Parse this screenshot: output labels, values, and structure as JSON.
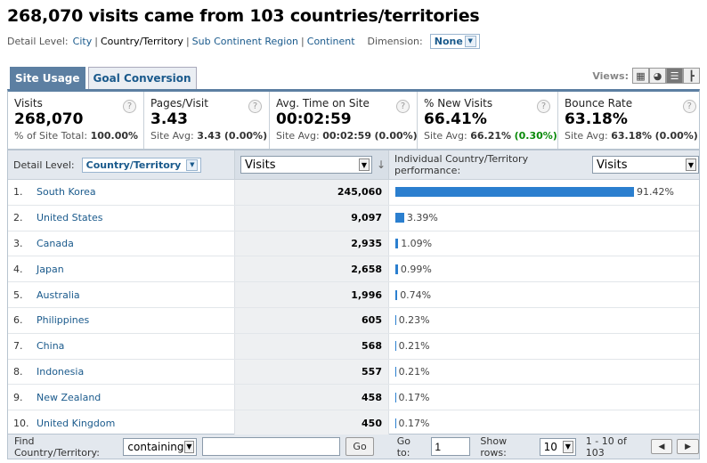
{
  "page": {
    "title": "268,070 visits came from 103 countries/territories"
  },
  "detail_level": {
    "label": "Detail Level:",
    "options": [
      "City",
      "Country/Territory",
      "Sub Continent Region",
      "Continent"
    ],
    "current": "Country/Territory",
    "dimension_label": "Dimension:",
    "dimension_value": "None"
  },
  "tabs": [
    {
      "label": "Site Usage",
      "active": true
    },
    {
      "label": "Goal Conversion",
      "active": false
    }
  ],
  "views": {
    "label": "Views:",
    "icons": [
      "table-icon",
      "pie-icon",
      "bar-icon",
      "comparison-icon"
    ],
    "active": "bar-icon"
  },
  "metrics": [
    {
      "label": "Visits",
      "value": "268,070",
      "sub_label": "% of Site Total:",
      "sub_value": "100.00%",
      "sub_extra": ""
    },
    {
      "label": "Pages/Visit",
      "value": "3.43",
      "sub_label": "Site Avg:",
      "sub_value": "3.43",
      "sub_extra": "(0.00%)"
    },
    {
      "label": "Avg. Time on Site",
      "value": "00:02:59",
      "sub_label": "Site Avg:",
      "sub_value": "00:02:59",
      "sub_extra": "(0.00%)"
    },
    {
      "label": "% New Visits",
      "value": "66.41%",
      "sub_label": "Site Avg:",
      "sub_value": "66.21%",
      "sub_extra": "(0.30%)"
    },
    {
      "label": "Bounce Rate",
      "value": "63.18%",
      "sub_label": "Site Avg:",
      "sub_value": "63.18%",
      "sub_extra": "(0.00%)"
    }
  ],
  "table": {
    "detail_label": "Detail Level:",
    "detail_value": "Country/Territory",
    "metric_select": "Visits",
    "performance_label": "Individual Country/Territory performance:",
    "performance_select": "Visits",
    "rows": [
      {
        "rank": "1.",
        "name": "South Korea",
        "visits": "245,060",
        "pct_label": "91.42%",
        "pct": 91.42
      },
      {
        "rank": "2.",
        "name": "United States",
        "visits": "9,097",
        "pct_label": "3.39%",
        "pct": 3.39
      },
      {
        "rank": "3.",
        "name": "Canada",
        "visits": "2,935",
        "pct_label": "1.09%",
        "pct": 1.09
      },
      {
        "rank": "4.",
        "name": "Japan",
        "visits": "2,658",
        "pct_label": "0.99%",
        "pct": 0.99
      },
      {
        "rank": "5.",
        "name": "Australia",
        "visits": "1,996",
        "pct_label": "0.74%",
        "pct": 0.74
      },
      {
        "rank": "6.",
        "name": "Philippines",
        "visits": "605",
        "pct_label": "0.23%",
        "pct": 0.23
      },
      {
        "rank": "7.",
        "name": "China",
        "visits": "568",
        "pct_label": "0.21%",
        "pct": 0.21
      },
      {
        "rank": "8.",
        "name": "Indonesia",
        "visits": "557",
        "pct_label": "0.21%",
        "pct": 0.21
      },
      {
        "rank": "9.",
        "name": "New Zealand",
        "visits": "458",
        "pct_label": "0.17%",
        "pct": 0.17
      },
      {
        "rank": "10.",
        "name": "United Kingdom",
        "visits": "450",
        "pct_label": "0.17%",
        "pct": 0.17
      }
    ]
  },
  "footer": {
    "find_label": "Find Country/Territory:",
    "match_select": "containing",
    "search_value": "",
    "go_button": "Go",
    "goto_label": "Go to:",
    "goto_value": "1",
    "show_rows_label": "Show rows:",
    "show_rows_value": "10",
    "range_text": "1 - 10 of 103"
  },
  "colors": {
    "accent": "#5c7fa2",
    "bar": "#2b7fcf",
    "link": "#1a5a8c",
    "positive": "#0a8a0a"
  }
}
